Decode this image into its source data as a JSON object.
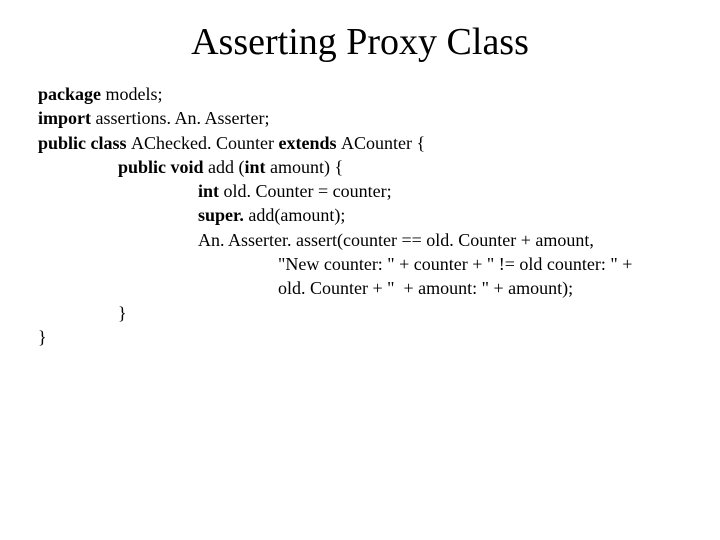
{
  "title": "Asserting Proxy Class",
  "code": {
    "l1a": "package ",
    "l1b": "models;",
    "l2a": "import ",
    "l2b": "assertions. An. Asserter;",
    "l3a": "public class ",
    "l3b": "AChecked. Counter ",
    "l3c": "extends ",
    "l3d": "ACounter {",
    "l4a": "public void ",
    "l4b": "add (",
    "l4c": "int ",
    "l4d": "amount) {",
    "l5a": "int ",
    "l5b": "old. Counter = counter;",
    "l6a": "super. ",
    "l6b": "add(amount);",
    "l7": "An. Asserter. assert(counter == old. Counter + amount,",
    "l8": "\"New counter: \" + counter + \" != old counter: \" +",
    "l9": "old. Counter + \"  + amount: \" + amount);",
    "l10": "}",
    "l11": "}"
  }
}
